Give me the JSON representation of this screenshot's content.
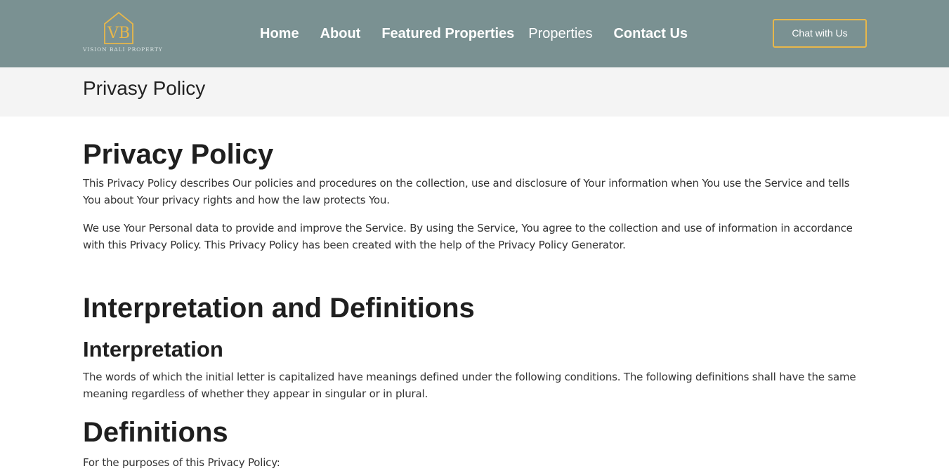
{
  "brand": {
    "monogram": "VB",
    "name": "VISION BALI PROPERTY",
    "accent": "#e8b74a",
    "header_bg": "#7a9192"
  },
  "nav": {
    "items": [
      {
        "label": "Home"
      },
      {
        "label": "About"
      },
      {
        "label": "Featured Properties"
      },
      {
        "label": "Properties"
      },
      {
        "label": "Contact Us"
      }
    ],
    "cta": "Chat with Us"
  },
  "page_title": "Privasy Policy",
  "article": {
    "h1": "Privacy Policy",
    "p1": "This Privacy Policy describes Our policies and procedures on the collection, use and disclosure of Your information when You use the Service and tells You about Your privacy rights and how the law protects You.",
    "p2": "We use Your Personal data to provide and improve the Service. By using the Service, You agree to the collection and use of information in accordance with this Privacy Policy. This Privacy Policy has been created with the help of the Privacy Policy Generator.",
    "h_interp_def": "Interpretation and Definitions",
    "h_interp": "Interpretation",
    "p_interp": "The words of which the initial letter is capitalized have meanings defined under the following conditions. The following definitions shall have the same meaning regardless of whether they appear in singular or in plural.",
    "h_defs": "Definitions",
    "p_defs": "For the purposes of this Privacy Policy:"
  }
}
